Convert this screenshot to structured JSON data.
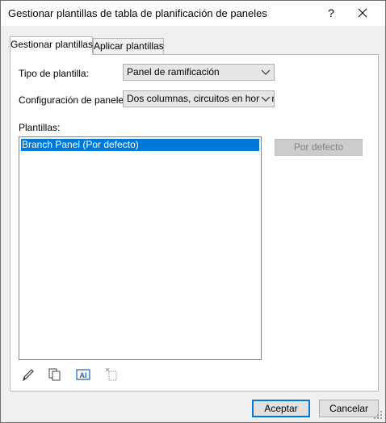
{
  "window": {
    "title": "Gestionar plantillas de tabla de planificación de paneles",
    "help_glyph": "?",
    "close_glyph": "✕"
  },
  "tabs": [
    {
      "label": "Gestionar plantillas",
      "active": true
    },
    {
      "label": "Aplicar plantillas",
      "active": false
    }
  ],
  "form": {
    "template_type_label": "Tipo de plantilla:",
    "template_type_value": "Panel de ramificación",
    "panel_config_label": "Configuración de paneles:",
    "panel_config_value": "Dos columnas, circuitos en horizon",
    "templates_label": "Plantillas:"
  },
  "templates": {
    "items": [
      {
        "label": "Branch Panel (Por defecto)",
        "selected": true
      }
    ]
  },
  "side_buttons": {
    "default_label": "Por defecto"
  },
  "toolbar_icons": [
    "edit-pencil-icon",
    "duplicate-icon",
    "rename-icon",
    "delete-icon"
  ],
  "footer": {
    "ok_label": "Aceptar",
    "cancel_label": "Cancelar"
  },
  "colors": {
    "accent": "#0078d7",
    "dialog_bg": "#f0f0f0",
    "panel_bg": "#ffffff"
  }
}
